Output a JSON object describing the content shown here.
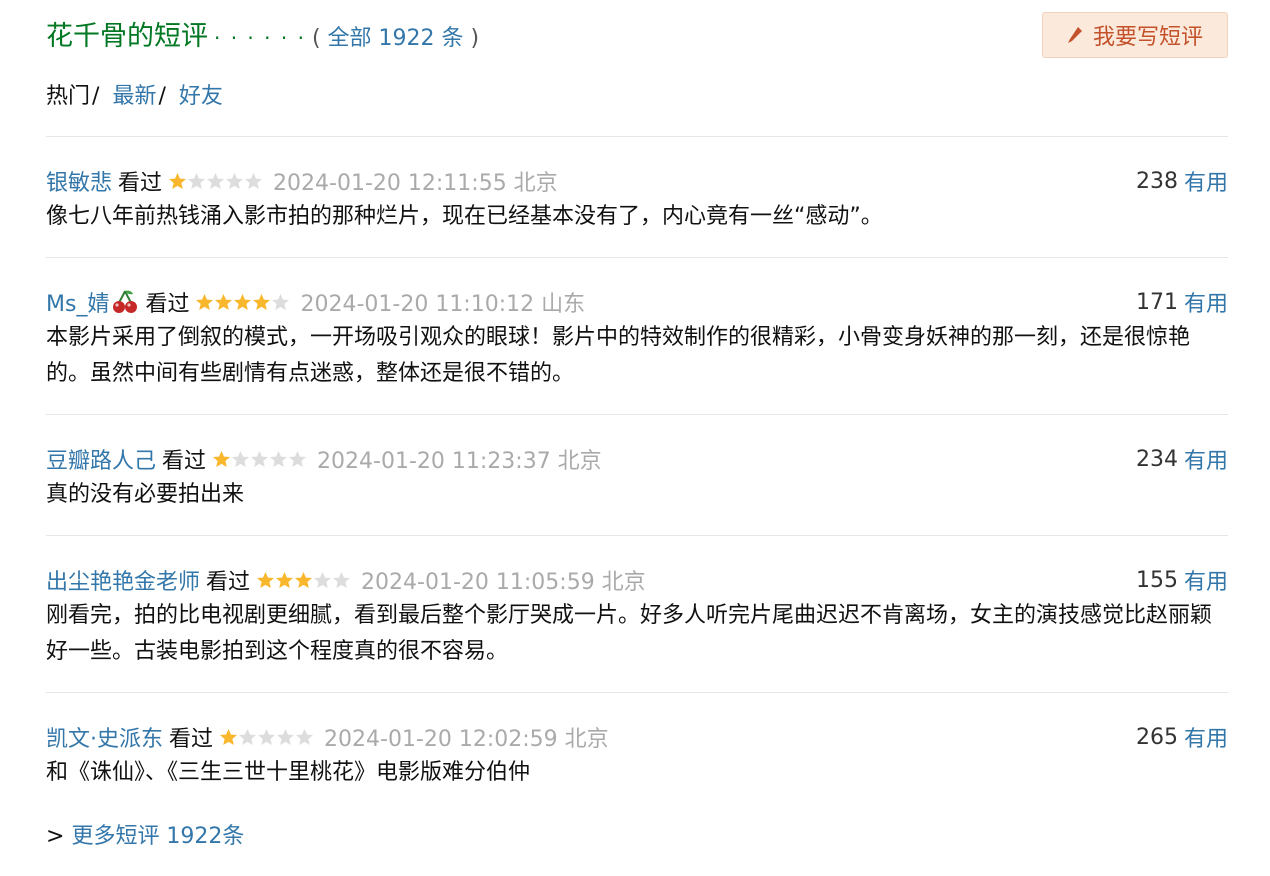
{
  "header": {
    "title": "花千骨的短评",
    "dots": "· · · · · ·",
    "all_prefix": "( ",
    "all_link": "全部 1922 条",
    "all_suffix": " )",
    "write_button": "我要写短评"
  },
  "sort": {
    "hot": "热门",
    "sep": "/",
    "latest": "最新",
    "friends": "好友"
  },
  "reviews": [
    {
      "user": "银敏悲",
      "watched": "看过",
      "rating": 1,
      "time": "2024-01-20 12:11:55 北京",
      "votes": "238",
      "useful": "有用",
      "text": "像七八年前热钱涌入影市拍的那种烂片，现在已经基本没有了，内心竟有一丝“感动”。"
    },
    {
      "user": "Ms_婧",
      "watched": "看过",
      "rating": 4,
      "time": "2024-01-20 11:10:12 山东",
      "votes": "171",
      "useful": "有用",
      "text": "本影片采用了倒叙的模式，一开场吸引观众的眼球！影片中的特效制作的很精彩，小骨变身妖神的那一刻，还是很惊艳的。虽然中间有些剧情有点迷惑，整体还是很不错的。"
    },
    {
      "user": "豆瓣路人己",
      "watched": "看过",
      "rating": 1,
      "time": "2024-01-20 11:23:37 北京",
      "votes": "234",
      "useful": "有用",
      "text": "真的没有必要拍出来"
    },
    {
      "user": "出尘艳艳金老师",
      "watched": "看过",
      "rating": 3,
      "time": "2024-01-20 11:05:59 北京",
      "votes": "155",
      "useful": "有用",
      "text": "刚看完，拍的比电视剧更细腻，看到最后整个影厅哭成一片。好多人听完片尾曲迟迟不肯离场，女主的演技感觉比赵丽颖好一些。古装电影拍到这个程度真的很不容易。"
    },
    {
      "user": "凯文·史派东",
      "watched": "看过",
      "rating": 1,
      "time": "2024-01-20 12:02:59 北京",
      "votes": "265",
      "useful": "有用",
      "text": "和《诛仙》、《三生三世十里桃花》电影版难分伯仲"
    }
  ],
  "more": {
    "prefix": "> ",
    "link": "更多短评 1922条"
  },
  "colors": {
    "title_green": "#007722",
    "link_blue": "#3377aa",
    "star_on": "#f8b72d",
    "star_off": "#dddddd",
    "button_bg": "#fbe9dc",
    "button_text": "#c3522b"
  },
  "icons": {
    "write": "pencil-icon",
    "cherry": "cherry-icon",
    "star": "star-icon"
  }
}
